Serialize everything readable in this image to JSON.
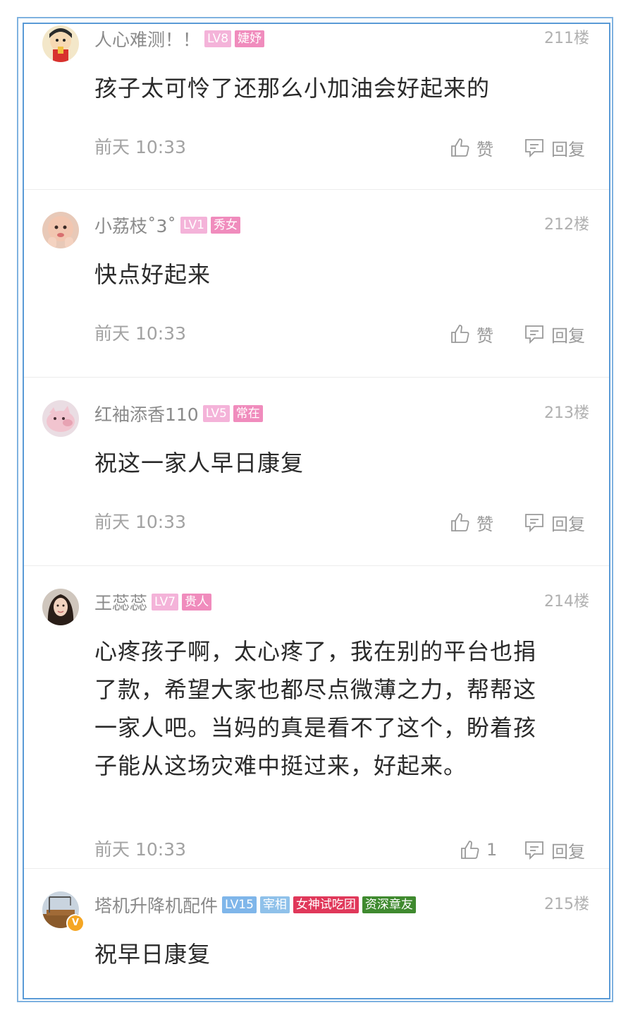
{
  "labels": {
    "like": "赞",
    "reply": "回复"
  },
  "colors": {
    "level_badge": "#f4b3d9",
    "title_badge": "#f08cbd",
    "level_badge_blue": "#7fb6ea",
    "title_badge_blue": "#8fc1ea",
    "special_badge_red": "#e0385a",
    "special_badge_green": "#3f8a2f",
    "frame": "#5a9ad6"
  },
  "comments": [
    {
      "username": "人心难测！！",
      "level": "LV8",
      "title": "婕妤",
      "floor": "211楼",
      "content": "孩子太可怜了还那么小加油会好起来的",
      "time": "前天 10:33",
      "like": "赞"
    },
    {
      "username": "小荔枝˚3˚",
      "level": "LV1",
      "title": "秀女",
      "floor": "212楼",
      "content": "快点好起来",
      "time": "前天 10:33",
      "like": "赞"
    },
    {
      "username": "红袖添香110",
      "level": "LV5",
      "title": "常在",
      "floor": "213楼",
      "content": "祝这一家人早日康复",
      "time": "前天 10:33",
      "like": "赞"
    },
    {
      "username": "王蕊蕊",
      "level": "LV7",
      "title": "贵人",
      "floor": "214楼",
      "content_lines": [
        "心疼孩子啊，太心疼了，我在别的平台也捐",
        "了款，希望大家也都尽点微薄之力，帮帮这",
        "一家人吧。当妈的真是看不了这个，盼着孩",
        "子能从这场灾难中挺过来，好起来。"
      ],
      "time": "前天 10:33",
      "like": "1"
    },
    {
      "username": "塔机升降机配件",
      "level": "LV15",
      "title": "宰相",
      "badge3": "女神试吃团",
      "badge4": "资深章友",
      "floor": "215楼",
      "content": "祝早日康复",
      "verified_mark": "V"
    }
  ]
}
